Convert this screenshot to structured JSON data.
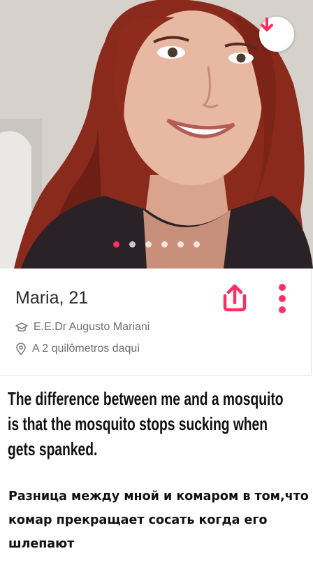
{
  "profile": {
    "name_age": "Maria, 21",
    "school": "E.E.Dr Augusto Mariani",
    "distance": "A 2 quilômetros daqui"
  },
  "photo": {
    "total_photos": 6,
    "active_photo_index": 0
  },
  "icons": {
    "down": "arrow-down-icon",
    "share": "share-icon",
    "more": "more-vertical-icon",
    "school": "graduation-cap-icon",
    "location": "location-pin-icon"
  },
  "colors": {
    "accent": "#fd2f63",
    "text": "#2a2a2a",
    "muted": "#6e6e6e"
  },
  "caption": {
    "english": "The difference between me and a mosquito is that the mosquito stops sucking when gets spanked.",
    "russian": "Разница между мной и комаром в том,что комар прекращает сосать когда его шлепают"
  }
}
